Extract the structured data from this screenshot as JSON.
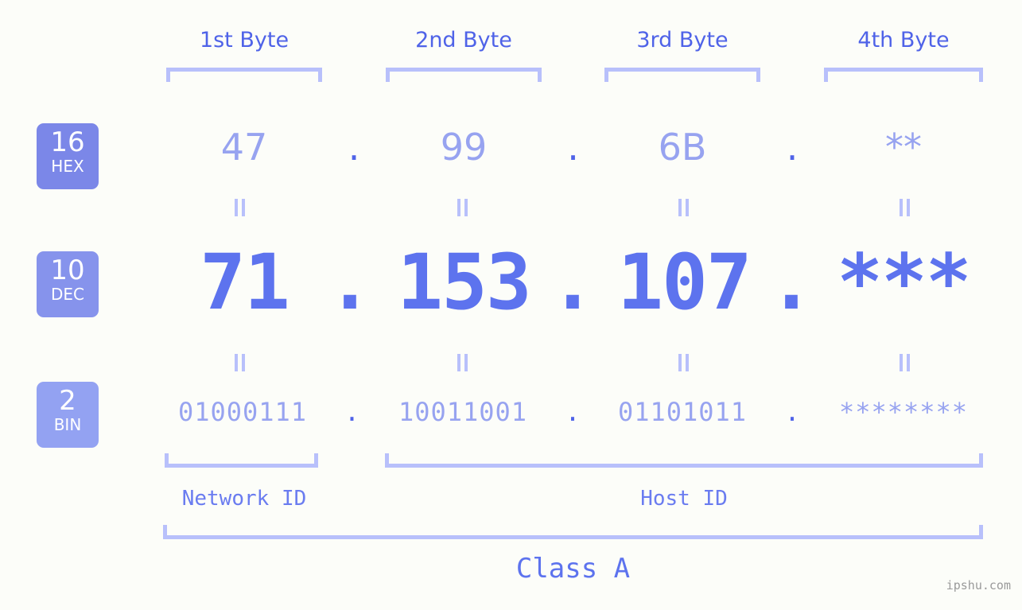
{
  "page": {
    "background_color": "#fcfdf9",
    "accent_color": "#5d73ee",
    "light_accent_color": "#97a3f0",
    "bracket_color": "#b8c0fb",
    "badge_color_hex": "#7b87e8",
    "badge_color_dec": "#8693ec",
    "badge_color_bin": "#93a2f2"
  },
  "byte_headers": [
    {
      "label": "1st Byte"
    },
    {
      "label": "2nd Byte"
    },
    {
      "label": "3rd Byte"
    },
    {
      "label": "4th Byte"
    }
  ],
  "bases": [
    {
      "number": "16",
      "abbr": "HEX"
    },
    {
      "number": "10",
      "abbr": "DEC"
    },
    {
      "number": "2",
      "abbr": "BIN"
    }
  ],
  "rows": {
    "hex": {
      "values": [
        "47",
        "99",
        "6B",
        "**"
      ],
      "separator": "."
    },
    "dec": {
      "values": [
        "71",
        "153",
        "107",
        "***"
      ],
      "separator": "."
    },
    "bin": {
      "values": [
        "01000111",
        "10011001",
        "01101011",
        "********"
      ],
      "separator": "."
    }
  },
  "equality_marks": {
    "symbol": "=",
    "count_per_row": 4,
    "rows": 2
  },
  "id_sections": [
    {
      "label": "Network ID"
    },
    {
      "label": "Host ID"
    }
  ],
  "class": {
    "label": "Class A"
  },
  "watermark": {
    "text": "ipshu.com"
  }
}
